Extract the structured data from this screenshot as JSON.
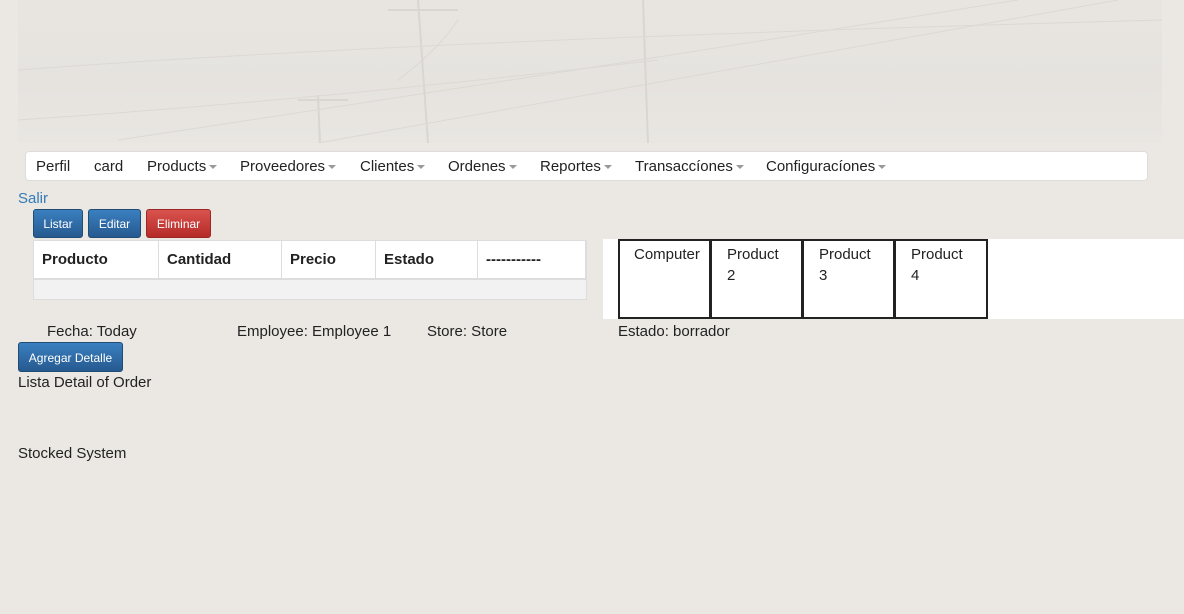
{
  "nav": {
    "items": [
      {
        "label": "Perfil",
        "dropdown": false
      },
      {
        "label": "card",
        "dropdown": false
      },
      {
        "label": "Products",
        "dropdown": true
      },
      {
        "label": "Proveedores",
        "dropdown": true
      },
      {
        "label": "Clientes",
        "dropdown": true
      },
      {
        "label": "Ordenes",
        "dropdown": true
      },
      {
        "label": "Reportes",
        "dropdown": true
      },
      {
        "label": "Transaccíones",
        "dropdown": true
      },
      {
        "label": "Configuracíones",
        "dropdown": true
      }
    ]
  },
  "logout_label": "Salir",
  "toolbar": {
    "list_label": "Listar",
    "edit_label": "Editar",
    "delete_label": "Eliminar"
  },
  "table": {
    "headers": [
      "Producto",
      "Cantidad",
      "Precio",
      "Estado",
      "-----------"
    ],
    "rows": []
  },
  "products": [
    {
      "line1": "Computer",
      "line2": ""
    },
    {
      "line1": "Product",
      "line2": "2"
    },
    {
      "line1": "Product",
      "line2": "3"
    },
    {
      "line1": "Product",
      "line2": "4"
    }
  ],
  "order": {
    "fecha": "Fecha: Today",
    "employee": "Employee: Employee 1",
    "store": "Store: Store",
    "estado": "Estado: borrador"
  },
  "add_detail_label": "Agregar Detalle",
  "detail_list_title": "Lista Detail of Order",
  "footer_text": "Stocked System",
  "colors": {
    "primary": "#337ab7",
    "danger": "#d9534f",
    "background": "#ebe8e4"
  }
}
